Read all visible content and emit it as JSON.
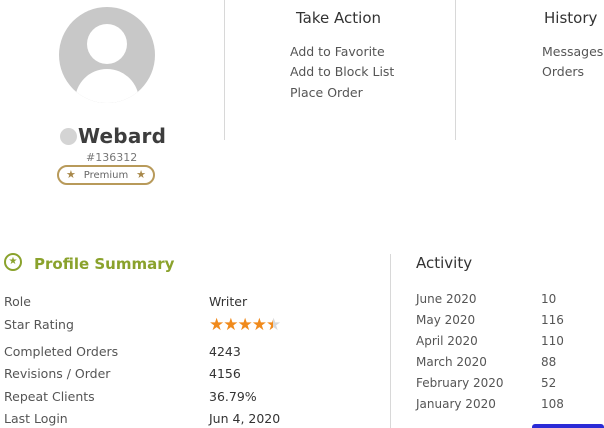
{
  "profile": {
    "username": "Webard",
    "user_id": "#136312",
    "badge": "Premium"
  },
  "take_action": {
    "title": "Take Action",
    "items": [
      "Add to Favorite",
      "Add to Block List",
      "Place Order"
    ]
  },
  "history": {
    "title": "History",
    "items": [
      "Messages",
      "Orders"
    ]
  },
  "summary": {
    "title": "Profile Summary",
    "rows": [
      {
        "label": "Role",
        "value": "Writer"
      },
      {
        "label": "Star Rating",
        "value": 4.5
      },
      {
        "label": "Completed Orders",
        "value": "4243"
      },
      {
        "label": "Revisions / Order",
        "value": "4156"
      },
      {
        "label": "Repeat Clients",
        "value": "36.79%"
      },
      {
        "label": "Last Login",
        "value": "Jun 4, 2020"
      }
    ]
  },
  "activity": {
    "title": "Activity",
    "rows": [
      {
        "month": "June 2020",
        "value": "10"
      },
      {
        "month": "May 2020",
        "value": "116"
      },
      {
        "month": "April 2020",
        "value": "110"
      },
      {
        "month": "March 2020",
        "value": "88"
      },
      {
        "month": "February 2020",
        "value": "52"
      },
      {
        "month": "January 2020",
        "value": "108"
      }
    ]
  },
  "colors": {
    "accent_green": "#8aa22c",
    "star_orange": "#f08a1c",
    "badge_gold": "#b89a5a"
  }
}
